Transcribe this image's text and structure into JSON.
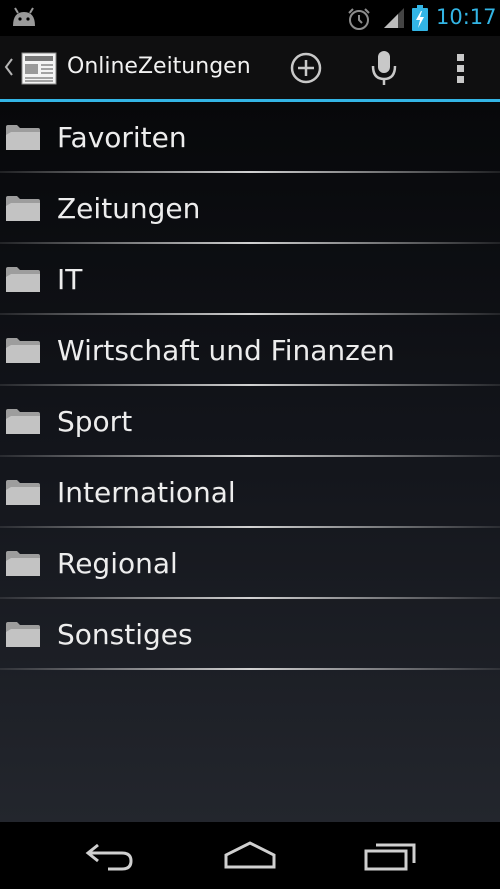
{
  "status_bar": {
    "time": "10:17",
    "icons": [
      "android-icon",
      "alarm-icon",
      "signal-icon",
      "battery-charging-icon"
    ],
    "accent_color": "#33b5e5"
  },
  "action_bar": {
    "title": "OnlineZeitungen",
    "icons": [
      "up-caret-icon",
      "newspaper-app-icon",
      "add-icon",
      "microphone-icon",
      "overflow-menu-icon"
    ]
  },
  "list": {
    "items": [
      {
        "label": "Favoriten",
        "icon": "folder-icon"
      },
      {
        "label": "Zeitungen",
        "icon": "folder-icon"
      },
      {
        "label": "IT",
        "icon": "folder-icon"
      },
      {
        "label": "Wirtschaft und Finanzen",
        "icon": "folder-icon"
      },
      {
        "label": "Sport",
        "icon": "folder-icon"
      },
      {
        "label": "International",
        "icon": "folder-icon"
      },
      {
        "label": "Regional",
        "icon": "folder-icon"
      },
      {
        "label": "Sonstiges",
        "icon": "folder-icon"
      }
    ]
  },
  "nav_bar": {
    "icons": [
      "back-icon",
      "home-icon",
      "recent-apps-icon"
    ]
  }
}
